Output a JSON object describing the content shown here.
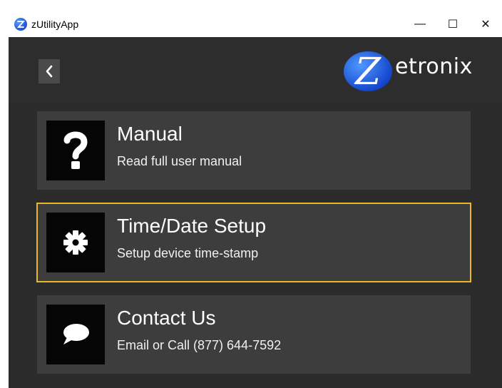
{
  "window": {
    "title": "zUtilityApp",
    "controls": {
      "minimize": "—",
      "maximize": "☐",
      "close": "✕"
    }
  },
  "header": {
    "back_icon": "chevron-left-icon",
    "logo_letter": "Z",
    "logo_text": "etronix"
  },
  "menu": [
    {
      "title": "Manual",
      "subtitle": "Read full user manual",
      "icon": "question-mark-icon",
      "selected": false
    },
    {
      "title": "Time/Date Setup",
      "subtitle": "Setup device time-stamp",
      "icon": "gear-icon",
      "selected": true
    },
    {
      "title": "Contact Us",
      "subtitle": "Email or Call (877) 644-7592",
      "icon": "chat-bubble-icon",
      "selected": false
    }
  ],
  "colors": {
    "background": "#2b2b2b",
    "card": "#3d3d3d",
    "icon_box": "#050505",
    "selection": "#e8b828",
    "logo_blue": "#1a5ee0"
  }
}
